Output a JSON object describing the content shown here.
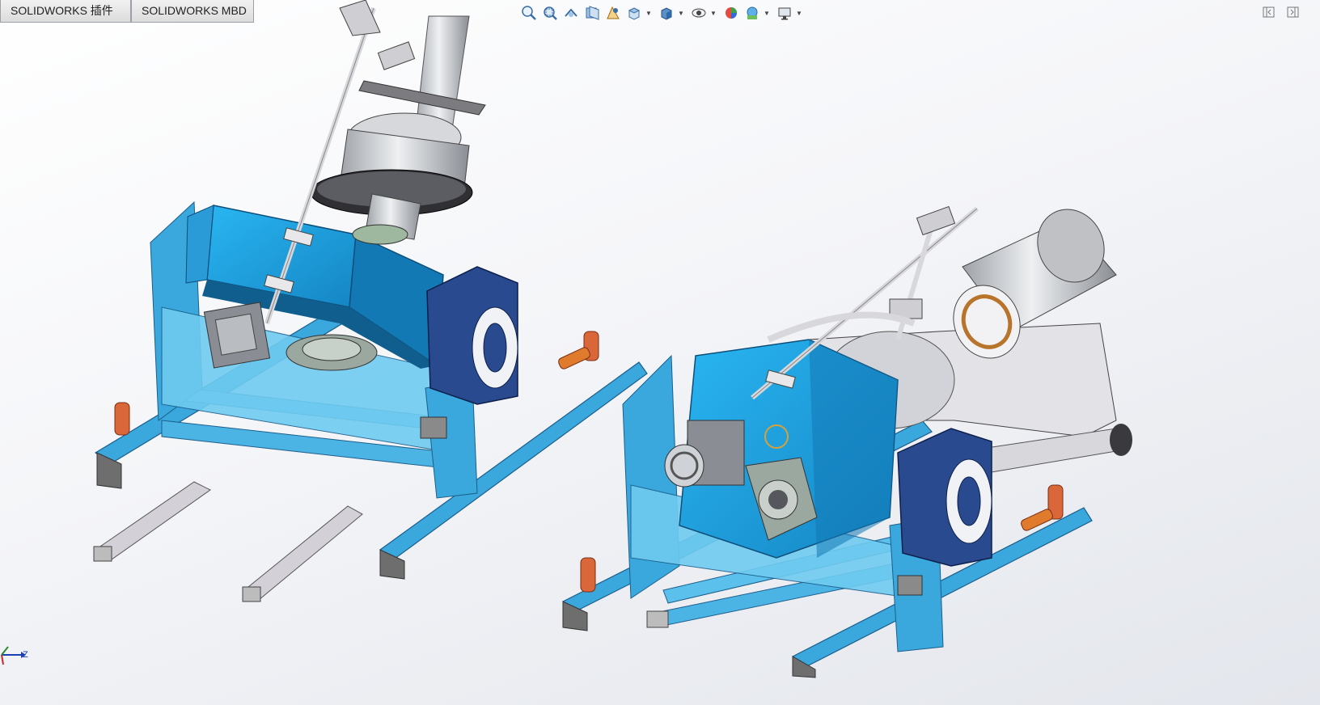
{
  "tabs": [
    {
      "label": "SOLIDWORKS 插件"
    },
    {
      "label": "SOLIDWORKS MBD"
    }
  ],
  "heads_up_toolbar": [
    {
      "icon": "zoom-to-fit-icon"
    },
    {
      "icon": "zoom-to-area-icon"
    },
    {
      "icon": "previous-view-icon"
    },
    {
      "icon": "section-view-icon"
    },
    {
      "icon": "dynamic-annotation-icon"
    },
    {
      "icon": "view-orientation-icon"
    },
    {
      "icon": "display-style-icon"
    },
    {
      "icon": "hide-show-items-icon"
    },
    {
      "icon": "edit-appearance-icon"
    },
    {
      "icon": "apply-scene-icon"
    },
    {
      "icon": "view-settings-icon"
    }
  ],
  "triad": {
    "axis_label": "Z"
  },
  "colors": {
    "frame_blue": "#3aa7dd",
    "frame_dark": "#1f6fa3",
    "gearbox_blue": "#1fa4e6",
    "bearing_navy": "#2a4a8f",
    "copper_post": "#d9673a",
    "steel_gray": "#c8c8cc"
  }
}
